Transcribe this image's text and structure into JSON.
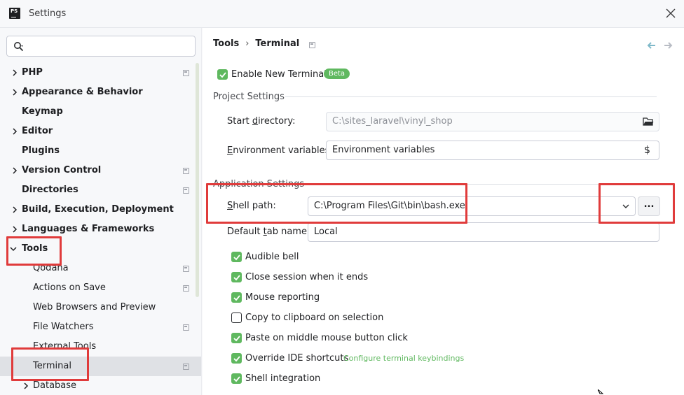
{
  "window": {
    "title": "Settings",
    "logo_text": "PS"
  },
  "search": {
    "placeholder": "",
    "value": ""
  },
  "sidebar": {
    "items": [
      {
        "label": "PHP"
      },
      {
        "label": "Appearance & Behavior"
      },
      {
        "label": "Keymap"
      },
      {
        "label": "Editor"
      },
      {
        "label": "Plugins"
      },
      {
        "label": "Version Control"
      },
      {
        "label": "Directories"
      },
      {
        "label": "Build, Execution, Deployment"
      },
      {
        "label": "Languages & Frameworks"
      },
      {
        "label": "Tools"
      },
      {
        "label": "Qodana"
      },
      {
        "label": "Actions on Save"
      },
      {
        "label": "Web Browsers and Preview"
      },
      {
        "label": "File Watchers"
      },
      {
        "label": "External Tools"
      },
      {
        "label": "Terminal"
      },
      {
        "label": "Database"
      }
    ]
  },
  "breadcrumb": {
    "parent": "Tools",
    "separator": "›",
    "current": "Terminal"
  },
  "enable_terminal": {
    "label": "Enable New Terminal",
    "badge": "Beta",
    "checked": true
  },
  "project_settings": {
    "title": "Project Settings",
    "start_directory": {
      "label_pre": "Start ",
      "label_u": "d",
      "label_post": "irectory:",
      "value": "C:\\sites_laravel\\vinyl_shop"
    },
    "env_vars": {
      "label_pre": "",
      "label_u": "E",
      "label_post": "nvironment variables:",
      "value": "Environment variables",
      "icon_text": "$"
    }
  },
  "app_settings": {
    "title": "Application Settings",
    "shell_path": {
      "label_pre": "",
      "label_u": "S",
      "label_post": "hell path:",
      "value": "C:\\Program Files\\Git\\bin\\bash.exe",
      "browse_label": "..."
    },
    "default_tab": {
      "label_pre": "Default ",
      "label_u": "t",
      "label_post": "ab name:",
      "value": "Local"
    },
    "options": [
      {
        "label": "Audible bell",
        "checked": true
      },
      {
        "label": "Close session when it ends",
        "checked": true
      },
      {
        "label": "Mouse reporting",
        "checked": true
      },
      {
        "label": "Copy to clipboard on selection",
        "checked": false
      },
      {
        "label": "Paste on middle mouse button click",
        "checked": true
      },
      {
        "label": "Override IDE shortcuts",
        "checked": true
      },
      {
        "label": "Shell integration",
        "checked": true
      }
    ],
    "keybindings_link": "Configure terminal keybindings"
  },
  "colors": {
    "accent_green": "#5fb85f",
    "highlight_red": "#e03b3b"
  }
}
